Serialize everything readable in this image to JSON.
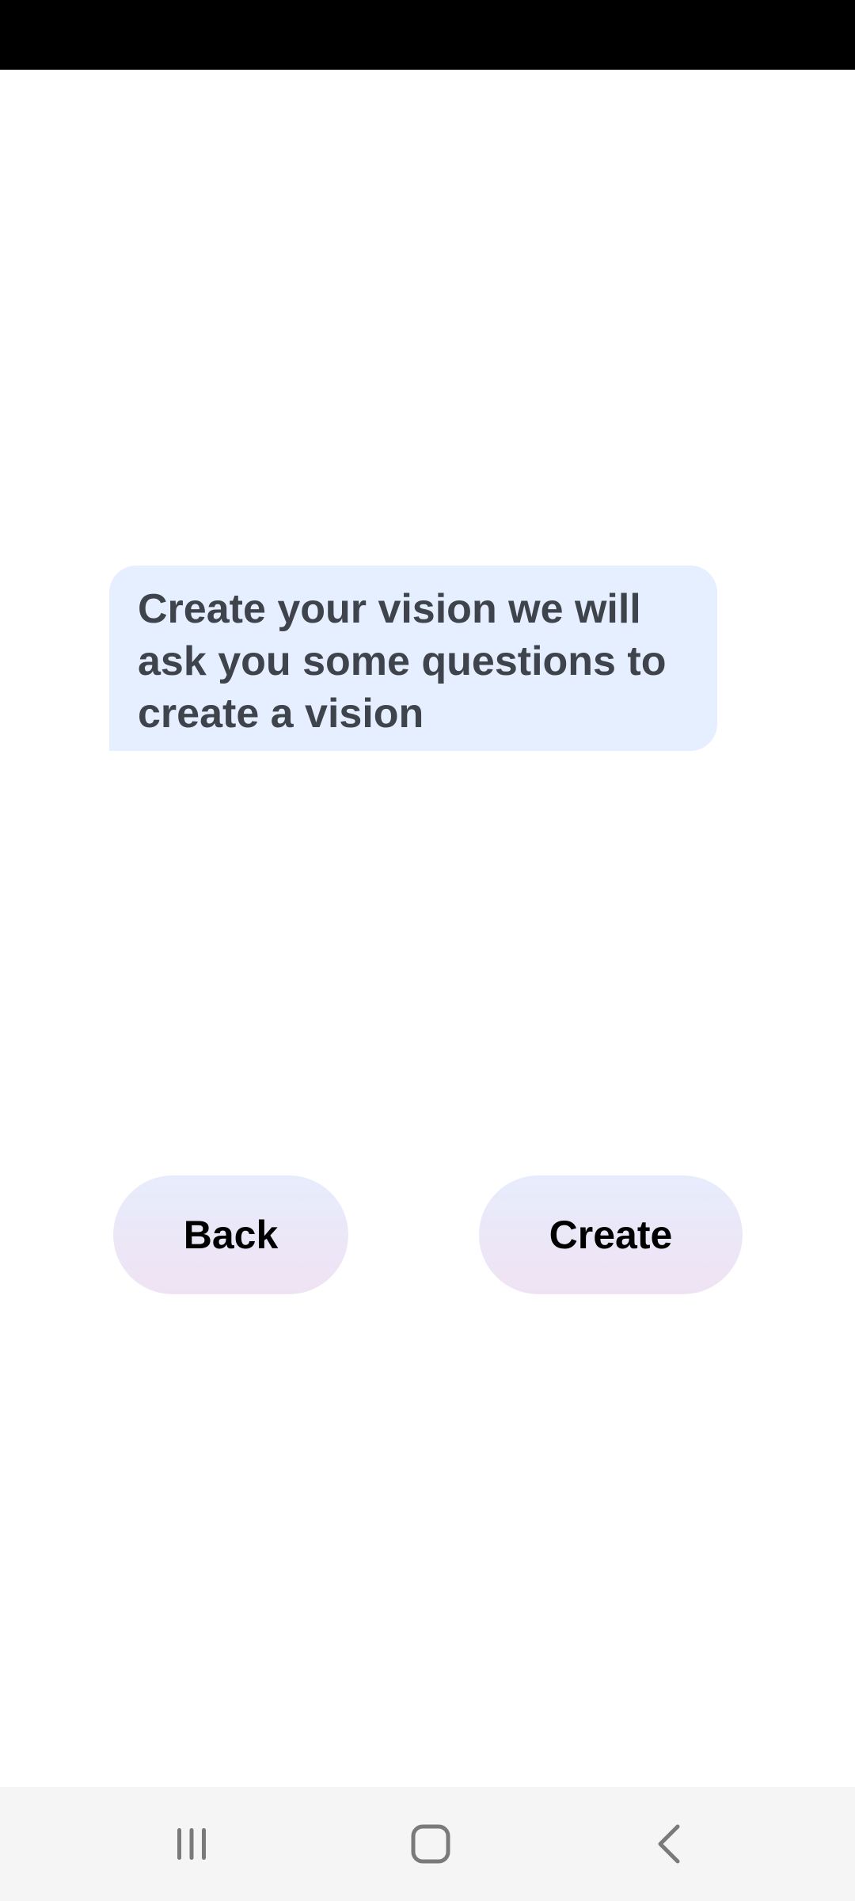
{
  "message": {
    "text": "Create your vision we will ask you some questions to create a vision"
  },
  "actions": {
    "back_label": "Back",
    "create_label": "Create"
  },
  "colors": {
    "bubble_bg": "#e6efff",
    "bubble_text": "#3f444c",
    "button_gradient_top": "#e7ecfc",
    "button_gradient_bottom": "#efe3f3",
    "status_bar": "#000000",
    "nav_bar": "#f5f5f5",
    "nav_icon": "#7a7a7a"
  },
  "icons": {
    "nav_recents": "recents-icon",
    "nav_home": "home-icon",
    "nav_back": "back-icon"
  }
}
